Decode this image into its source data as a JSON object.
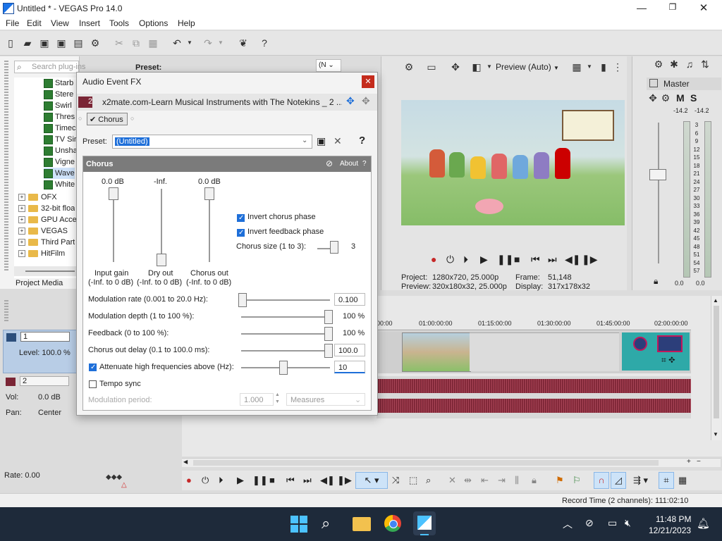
{
  "window": {
    "title": "Untitled * - VEGAS Pro 14.0"
  },
  "menu": [
    "File",
    "Edit",
    "View",
    "Insert",
    "Tools",
    "Options",
    "Help"
  ],
  "plugins": {
    "search_placeholder": "Search plug-ins",
    "preset_label": "Preset:",
    "items": [
      "Starb",
      "Stere",
      "Swirl",
      "Thres",
      "Timec",
      "TV Sir",
      "Unsha",
      "Vigne",
      "Wave",
      "White"
    ],
    "folders": [
      "OFX",
      "32-bit floa",
      "GPU Acce",
      "VEGAS",
      "Third Part",
      "HitFilm"
    ],
    "tab": "Project Media"
  },
  "preview": {
    "mode": "Preview (Auto)",
    "project_label": "Project:",
    "project_value": "1280x720, 25.000p",
    "preview_label": "Preview:",
    "preview_value": "320x180x32, 25.000p",
    "frame_label": "Frame:",
    "frame_value": "51,148",
    "display_label": "Display:",
    "display_value": "317x178x32"
  },
  "master": {
    "label": "Master",
    "m": "M",
    "s": "S",
    "peak_left": "-14.2",
    "peak_right": "-14.2",
    "scale": [
      "3",
      "6",
      "9",
      "12",
      "15",
      "18",
      "21",
      "24",
      "27",
      "30",
      "33",
      "36",
      "39",
      "42",
      "45",
      "48",
      "51",
      "54",
      "57"
    ],
    "bottom_left": "0.0",
    "bottom_right": "0.0"
  },
  "dialog": {
    "title": "Audio Event FX",
    "track_number": "2",
    "event_name": "x2mate.com-Learn Musical Instruments with The Notekins _ 2 ...",
    "chain_item": "Chorus",
    "preset_label": "Preset:",
    "preset_value": "(Untitled)",
    "panel_title": "Chorus",
    "about": "About",
    "help": "?",
    "sliders": {
      "input_gain_value": "0.0 dB",
      "dry_out_value": "-Inf.",
      "chorus_out_value": "0.0 dB",
      "input_gain_label": "Input gain",
      "input_gain_range": "(-Inf. to 0 dB)",
      "dry_out_label": "Dry out",
      "dry_out_range": "(-Inf. to 0 dB)",
      "chorus_out_label": "Chorus out",
      "chorus_out_range": "(-Inf. to 0 dB)"
    },
    "invert_chorus_phase": "Invert chorus phase",
    "invert_feedback_phase": "Invert feedback phase",
    "chorus_size_label": "Chorus size (1 to 3):",
    "chorus_size_value": "3",
    "modulation_rate_label": "Modulation rate (0.001 to 20.0 Hz):",
    "modulation_rate_value": "0.100",
    "modulation_depth_label": "Modulation depth (1 to 100 %):",
    "modulation_depth_value": "100 %",
    "feedback_label": "Feedback (0 to 100 %):",
    "feedback_value": "100 %",
    "chorus_out_delay_label": "Chorus out delay (0.1 to 100.0 ms):",
    "chorus_out_delay_value": "100.0",
    "attenuate_label": "Attenuate high frequencies above (Hz):",
    "attenuate_value": "10",
    "tempo_sync_label": "Tempo sync",
    "modulation_period_label": "Modulation period:",
    "modulation_period_value": "1.000",
    "measures_value": "Measures"
  },
  "tracks": {
    "track1_number": "1",
    "level_text": "Level: 100.0 %",
    "track2_number": "2",
    "vol_label": "Vol:",
    "vol_value": "0.0 dB",
    "pan_label": "Pan:",
    "pan_value": "Center"
  },
  "timeline": {
    "marks": [
      "00:00",
      "01:00:00:00",
      "01:15:00:00",
      "01:30:00:00",
      "01:45:00:00",
      "02:00:00:00"
    ]
  },
  "transport": {
    "rate_text": "Rate: 0.00"
  },
  "status": {
    "record_time": "Record Time (2 channels): 111:02:10"
  },
  "taskbar": {
    "time": "11:48 PM",
    "date": "12/21/2023"
  },
  "colors": {
    "accent": "#1e6fd9",
    "waveform": "#8b2c3d",
    "dialog_title_bg": "#f3f3f3",
    "panel_header": "#7b7b7b"
  }
}
